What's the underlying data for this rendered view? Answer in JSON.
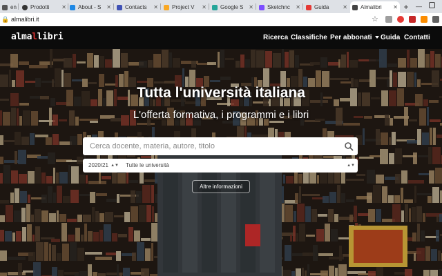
{
  "browser": {
    "tabs": [
      {
        "label": "en",
        "favicon": "dark-icon",
        "color": "#555555"
      },
      {
        "label": "Prodotti",
        "favicon": "github-icon",
        "color": "#333333"
      },
      {
        "label": "About - S",
        "favicon": "blue-app-icon",
        "color": "#1e88e5"
      },
      {
        "label": "Contacts",
        "favicon": "contacts-icon",
        "color": "#3f51b5"
      },
      {
        "label": "Project V",
        "favicon": "folder-icon",
        "color": "#f9a825"
      },
      {
        "label": "Google S",
        "favicon": "google-sheets-icon",
        "color": "#26a69a"
      },
      {
        "label": "Sketchnc",
        "favicon": "sketch-icon",
        "color": "#7c4dff"
      },
      {
        "label": "Guida",
        "favicon": "guide-icon",
        "color": "#e53935"
      },
      {
        "label": "Almalibri",
        "favicon": "almalibri-icon",
        "color": "#444444"
      }
    ],
    "active_tab_index": 8,
    "new_tab_label": "+",
    "url": "almalibri.it"
  },
  "navbar": {
    "logo_left": "alma",
    "logo_accent": "l",
    "logo_right": "libri",
    "links": [
      "Ricerca",
      "Classifiche",
      "Per abbonati",
      "Guida",
      "Contatti"
    ]
  },
  "hero": {
    "title": "Tutta l'università italiana",
    "subtitle": "L'offerta formativa, i programmi e i libri"
  },
  "search": {
    "placeholder": "Cerca docente, materia, autore, titolo",
    "year_value": "2020/21",
    "university_value": "Tutte le università",
    "more_button": "Altre informazioni"
  },
  "colors": {
    "navbar_bg": "#0b0b0b",
    "logo_accent": "#d32f2f"
  }
}
